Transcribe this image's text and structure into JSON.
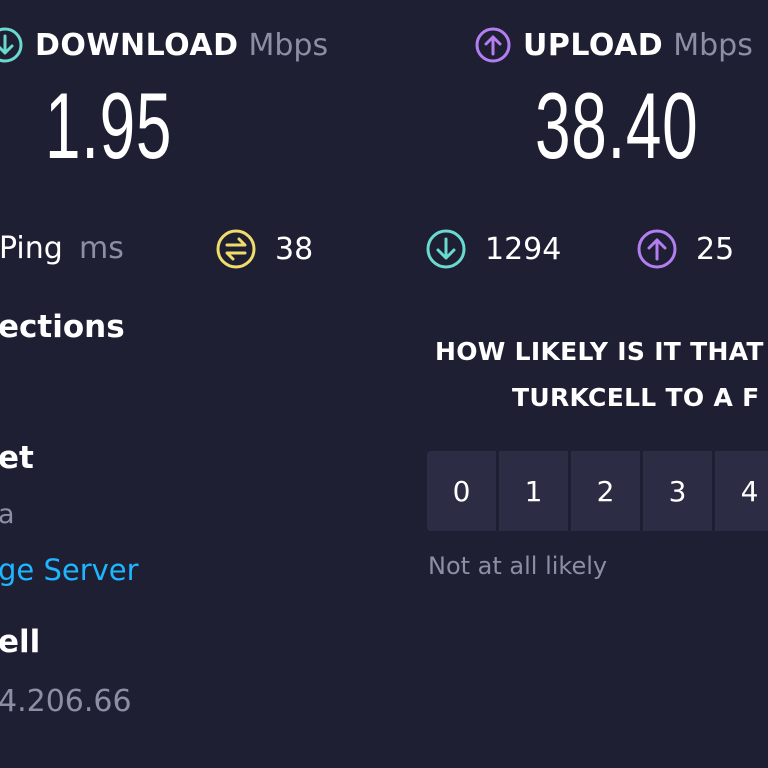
{
  "metrics": {
    "download": {
      "label": "DOWNLOAD",
      "unit": "Mbps",
      "value": "1.95",
      "icon": "arrow-down-circle-icon",
      "color": "#6ad9d0"
    },
    "upload": {
      "label": "UPLOAD",
      "unit": "Mbps",
      "value": "38.40",
      "icon": "arrow-up-circle-icon",
      "color": "#b27ef0"
    }
  },
  "ping": {
    "label": "Ping",
    "unit": "ms",
    "jitter": {
      "icon": "jitter-icon",
      "value": "38",
      "color": "#f1dc6a"
    },
    "download": {
      "icon": "arrow-down-circle-icon",
      "value": "1294",
      "color": "#6ad9d0"
    },
    "upload": {
      "icon": "arrow-up-circle-icon",
      "value": "25",
      "color": "#b27ef0"
    }
  },
  "connections": {
    "label": "ections"
  },
  "server": {
    "name": "et",
    "location": "a",
    "change_link": "ge Server"
  },
  "host": {
    "name": "ell",
    "ip": "4.206.66"
  },
  "survey": {
    "question_line1": "HOW LIKELY IS IT THAT",
    "question_line2": "TURKCELL TO A F",
    "ratings": [
      "0",
      "1",
      "2",
      "3",
      "4"
    ],
    "low_label": "Not at all likely"
  }
}
